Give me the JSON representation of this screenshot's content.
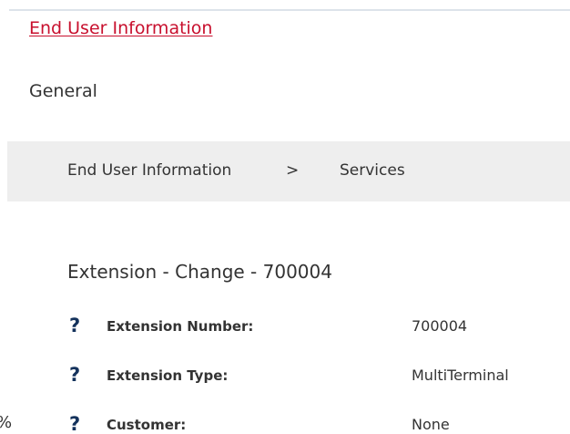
{
  "header": {
    "end_user_info_link": "End User Information",
    "general_heading": "General"
  },
  "breadcrumb": {
    "items": [
      "End User Information",
      "Services"
    ],
    "separator": ">"
  },
  "section": {
    "title": "Extension - Change - 700004"
  },
  "fields": [
    {
      "label": "Extension Number:",
      "value": "700004"
    },
    {
      "label": "Extension Type:",
      "value": "MultiTerminal"
    },
    {
      "label": "Customer:",
      "value": "None"
    }
  ],
  "help_icon_glyph": "?",
  "edge_glyph": "%",
  "colors": {
    "link": "#c8102e",
    "help_icon": "#14325c",
    "breadcrumb_bg": "#eeeeee",
    "text": "#333333"
  }
}
